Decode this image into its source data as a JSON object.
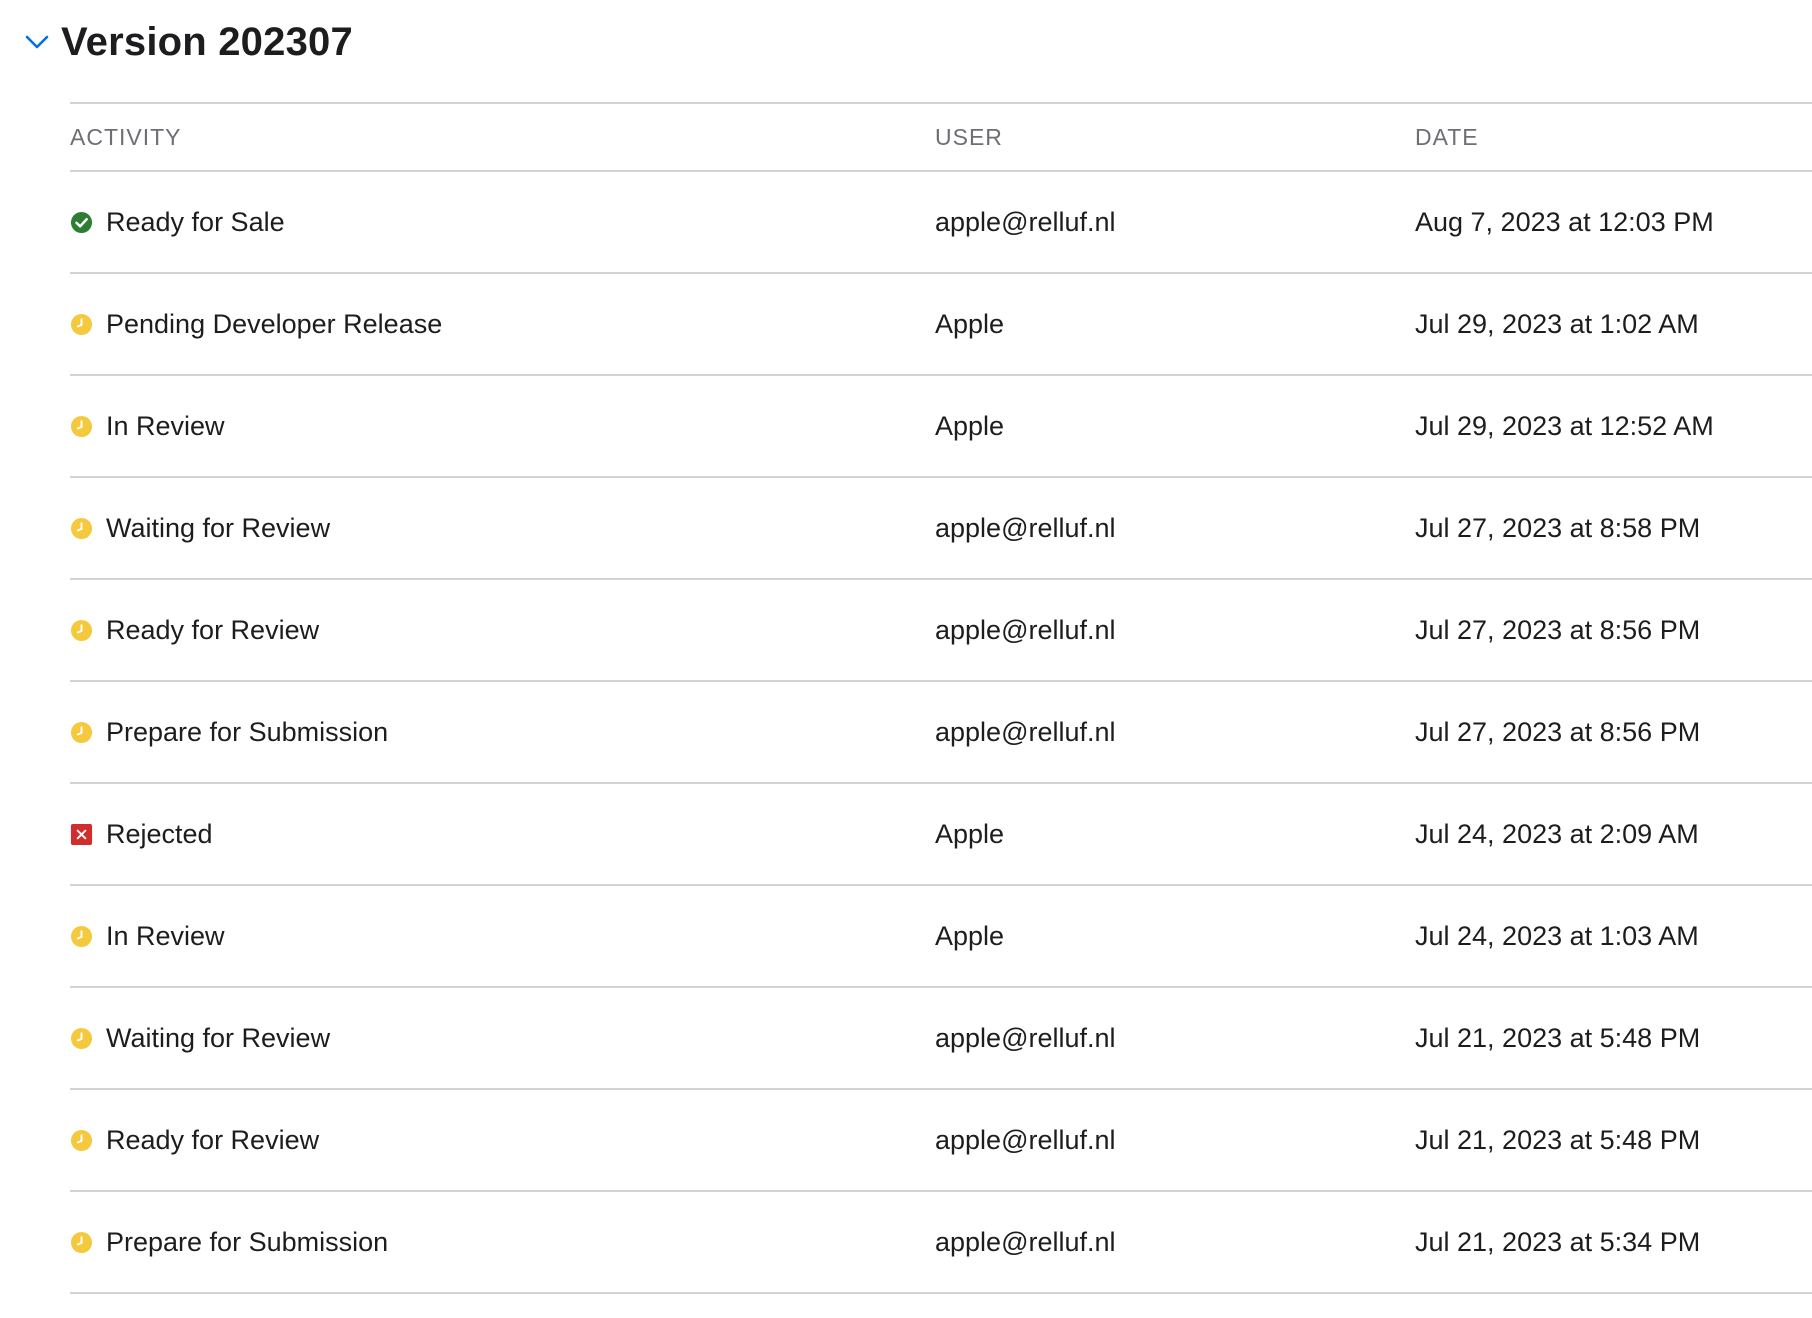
{
  "section": {
    "title": "Version 202307",
    "toggle_icon": "chevron-down-icon",
    "expanded": true
  },
  "table": {
    "headers": {
      "activity": "ACTIVITY",
      "user": "USER",
      "date": "DATE"
    },
    "rows": [
      {
        "status": "success",
        "icon": "checkmark-circle-icon",
        "activity": "Ready for Sale",
        "user": "apple@relluf.nl",
        "date": "Aug 7, 2023 at 12:03 PM"
      },
      {
        "status": "pending",
        "icon": "clock-icon",
        "activity": "Pending Developer Release",
        "user": "Apple",
        "date": "Jul 29, 2023 at 1:02 AM"
      },
      {
        "status": "pending",
        "icon": "clock-icon",
        "activity": "In Review",
        "user": "Apple",
        "date": "Jul 29, 2023 at 12:52 AM"
      },
      {
        "status": "pending",
        "icon": "clock-icon",
        "activity": "Waiting for Review",
        "user": "apple@relluf.nl",
        "date": "Jul 27, 2023 at 8:58 PM"
      },
      {
        "status": "pending",
        "icon": "clock-icon",
        "activity": "Ready for Review",
        "user": "apple@relluf.nl",
        "date": "Jul 27, 2023 at 8:56 PM"
      },
      {
        "status": "pending",
        "icon": "clock-icon",
        "activity": "Prepare for Submission",
        "user": "apple@relluf.nl",
        "date": "Jul 27, 2023 at 8:56 PM"
      },
      {
        "status": "rejected",
        "icon": "x-square-icon",
        "activity": "Rejected",
        "user": "Apple",
        "date": "Jul 24, 2023 at 2:09 AM"
      },
      {
        "status": "pending",
        "icon": "clock-icon",
        "activity": "In Review",
        "user": "Apple",
        "date": "Jul 24, 2023 at 1:03 AM"
      },
      {
        "status": "pending",
        "icon": "clock-icon",
        "activity": "Waiting for Review",
        "user": "apple@relluf.nl",
        "date": "Jul 21, 2023 at 5:48 PM"
      },
      {
        "status": "pending",
        "icon": "clock-icon",
        "activity": "Ready for Review",
        "user": "apple@relluf.nl",
        "date": "Jul 21, 2023 at 5:48 PM"
      },
      {
        "status": "pending",
        "icon": "clock-icon",
        "activity": "Prepare for Submission",
        "user": "apple@relluf.nl",
        "date": "Jul 21, 2023 at 5:34 PM"
      }
    ]
  },
  "colors": {
    "accent": "#0071e3",
    "success": "#2d7d32",
    "pending": "#f5c93d",
    "rejected": "#d12d2d",
    "divider": "#d2d2d7",
    "header_text": "#6e6e73",
    "text": "#1d1d1f"
  }
}
